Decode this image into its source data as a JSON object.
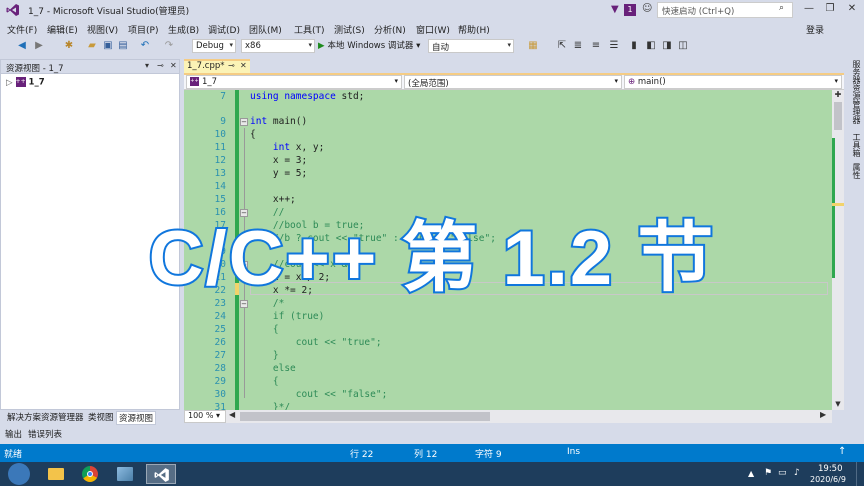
{
  "window": {
    "title": "1_7 - Microsoft Visual Studio(管理员)",
    "notification_count": "1",
    "quick_launch_placeholder": "快速启动 (Ctrl+Q)",
    "login": "登录"
  },
  "menu": [
    "文件(F)",
    "编辑(E)",
    "视图(V)",
    "项目(P)",
    "生成(B)",
    "调试(D)",
    "团队(M)",
    "工具(T)",
    "测试(S)",
    "分析(N)",
    "窗口(W)",
    "帮助(H)"
  ],
  "toolbar": {
    "config": "Debug",
    "platform": "x86",
    "run": "本地 Windows 调试器",
    "run_mode": "自动"
  },
  "left_panel": {
    "title": "资源视图 - 1_7",
    "tree_item": "1_7",
    "tabs": [
      "解决方案资源管理器",
      "类视图",
      "资源视图"
    ]
  },
  "editor": {
    "tab_label": "1_7.cpp*",
    "nav_project": "1_7",
    "nav_scope": "(全局范围)",
    "nav_member": "main()",
    "zoom": "100 %",
    "line_numbers": [
      "7",
      "9",
      "10",
      "11",
      "12",
      "13",
      "14",
      "15",
      "16",
      "17",
      "18",
      "19",
      "20",
      "21",
      "22",
      "23",
      "24",
      "25",
      "26",
      "27",
      "28",
      "29",
      "30",
      "31"
    ]
  },
  "code_lines": {
    "l7_kw": "using namespace",
    "l7_rest": " std;",
    "l9_kw": "int",
    "l9_rest": " main()",
    "l10": "{",
    "l11_kw": "    int",
    "l11_rest": " x, y;",
    "l12": "    x = 3;",
    "l13": "    y = 5;",
    "l15": "    x++;",
    "l16": "    //",
    "l17": "    //bool b = true;",
    "l18": "    //b ? cout << \"true\" : cout << \"false\";",
    "l20": "    //cout << x && ",
    "l21": "    x = x / 2;",
    "l22": "    x *= 2;",
    "l23": "    /*",
    "l24": "    if (true)",
    "l25": "    {",
    "l26_a": "        cout << ",
    "l26_s": "\"true\"",
    "l26_b": ";",
    "l27": "    }",
    "l28": "    else",
    "l29": "    {",
    "l30_a": "        cout << ",
    "l30_s": "\"false\"",
    "l30_b": ";",
    "l31": "    }*/"
  },
  "right_tabs": [
    "服务器资源管理器",
    "工具箱",
    "属性"
  ],
  "bottom_tabs": [
    "输出",
    "错误列表"
  ],
  "status": {
    "ready": "就绪",
    "line": "行 22",
    "col": "列 12",
    "char": "字符 9",
    "ins": "Ins"
  },
  "taskbar": {
    "time": "19:50",
    "date": "2020/6/9"
  },
  "overlay": {
    "caption": "C/C++ 第 1.2 节"
  },
  "colors": {
    "editor_background": "#acd8a8",
    "status_bar": "#007acc",
    "vs_purple": "#68217a",
    "caption_outline": "#1177dd"
  },
  "icons": [
    "vs-logo-icon",
    "filter-icon",
    "feedback-icon",
    "search-icon",
    "minimize-icon",
    "maximize-icon",
    "close-icon",
    "play-icon",
    "pin-icon",
    "windows-start-icon"
  ]
}
